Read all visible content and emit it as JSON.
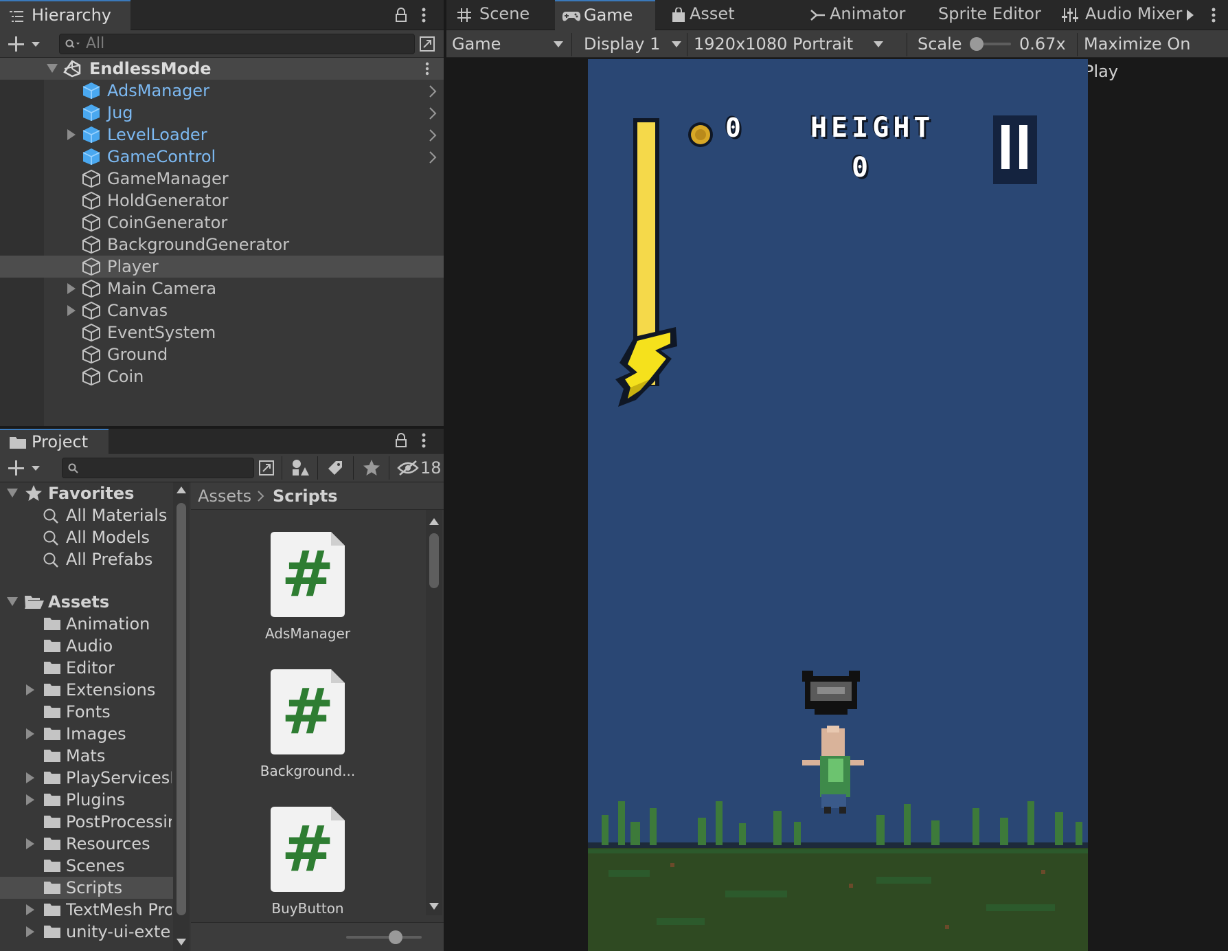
{
  "hierarchy": {
    "tab_label": "Hierarchy",
    "search_placeholder": "All",
    "scene_name": "EndlessMode",
    "items": [
      {
        "label": "AdsManager",
        "prefab": true,
        "expandable": false,
        "arrow": true
      },
      {
        "label": "Jug",
        "prefab": true,
        "expandable": false,
        "arrow": true
      },
      {
        "label": "LevelLoader",
        "prefab": true,
        "expandable": true,
        "arrow": true
      },
      {
        "label": "GameControl",
        "prefab": true,
        "expandable": false,
        "arrow": true
      },
      {
        "label": "GameManager",
        "prefab": false,
        "expandable": false
      },
      {
        "label": "HoldGenerator",
        "prefab": false,
        "expandable": false
      },
      {
        "label": "CoinGenerator",
        "prefab": false,
        "expandable": false
      },
      {
        "label": "BackgroundGenerator",
        "prefab": false,
        "expandable": false
      },
      {
        "label": "Player",
        "prefab": false,
        "expandable": false,
        "selected": true
      },
      {
        "label": "Main Camera",
        "prefab": false,
        "expandable": true
      },
      {
        "label": "Canvas",
        "prefab": false,
        "expandable": true
      },
      {
        "label": "EventSystem",
        "prefab": false,
        "expandable": false
      },
      {
        "label": "Ground",
        "prefab": false,
        "expandable": false
      },
      {
        "label": "Coin",
        "prefab": false,
        "expandable": false
      }
    ]
  },
  "project": {
    "tab_label": "Project",
    "hidden_count": "18",
    "favorites_label": "Favorites",
    "favorites": [
      "All Materials",
      "All Models",
      "All Prefabs"
    ],
    "assets_label": "Assets",
    "folders": [
      {
        "label": "Animation",
        "expandable": false
      },
      {
        "label": "Audio",
        "expandable": false
      },
      {
        "label": "Editor",
        "expandable": false
      },
      {
        "label": "Extensions",
        "expandable": true
      },
      {
        "label": "Fonts",
        "expandable": false
      },
      {
        "label": "Images",
        "expandable": true
      },
      {
        "label": "Mats",
        "expandable": false
      },
      {
        "label": "PlayServicesI",
        "expandable": true
      },
      {
        "label": "Plugins",
        "expandable": true
      },
      {
        "label": "PostProcessir",
        "expandable": false
      },
      {
        "label": "Resources",
        "expandable": true
      },
      {
        "label": "Scenes",
        "expandable": false
      },
      {
        "label": "Scripts",
        "expandable": false,
        "selected": true
      },
      {
        "label": "TextMesh Pro",
        "expandable": true
      },
      {
        "label": "unity-ui-exter",
        "expandable": true
      }
    ],
    "breadcrumb": [
      "Assets",
      "Scripts"
    ],
    "files": [
      "AdsManager",
      "Background...",
      "BuyButton"
    ],
    "file_glyph": "#"
  },
  "game_view": {
    "tabs": [
      "Scene",
      "Game",
      "Asset Store",
      "Animator",
      "Sprite Editor",
      "Audio Mixer"
    ],
    "active_tab": "Game",
    "game_dropdown": "Game",
    "display_dropdown": "Display 1",
    "resolution_dropdown": "1920x1080 Portrait",
    "scale_label": "Scale",
    "scale_value": "0.67x",
    "maximize_label": "Maximize On Play",
    "hud": {
      "coin_count": "0",
      "height_label": "HEIGHT",
      "height_value": "0"
    },
    "colors": {
      "sky": "#2a4774",
      "energy_bar": "#f5d94a",
      "bolt": "#f5e11c",
      "grass": "#2f5a2a"
    }
  }
}
